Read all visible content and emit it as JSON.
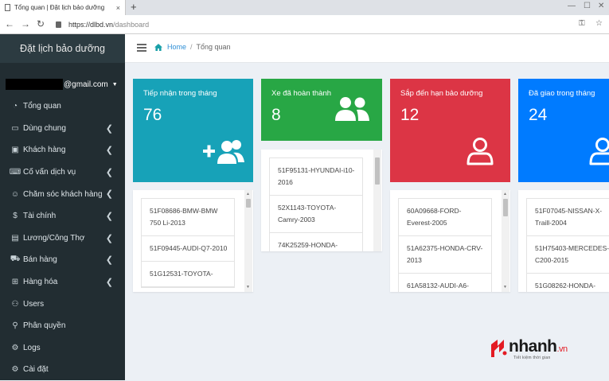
{
  "browser": {
    "tab_title": "Tổng quan | Đặt lịch bảo dưỡng",
    "tab_close": "×",
    "new_tab": "+",
    "url_scheme_host": "https://dlbd.vn",
    "url_path": "/dashboard"
  },
  "sidebar": {
    "brand": "Đặt lịch bảo dưỡng",
    "user_email": "@gmail.com",
    "items": [
      {
        "label": "Tổng quan",
        "icon": "dashboard-icon",
        "has_children": false
      },
      {
        "label": "Dùng chung",
        "icon": "folders-icon",
        "has_children": true
      },
      {
        "label": "Khách hàng",
        "icon": "id-card-icon",
        "has_children": true
      },
      {
        "label": "Cố vấn dịch vụ",
        "icon": "advisor-icon",
        "has_children": true
      },
      {
        "label": "Chăm sóc khách hàng",
        "icon": "support-icon",
        "has_children": true
      },
      {
        "label": "Tài chính",
        "icon": "dollar-icon",
        "has_children": true
      },
      {
        "label": "Lương/Công Thợ",
        "icon": "clipboard-icon",
        "has_children": true
      },
      {
        "label": "Bán hàng",
        "icon": "cart-icon",
        "has_children": true
      },
      {
        "label": "Hàng hóa",
        "icon": "gift-icon",
        "has_children": true
      },
      {
        "label": "Users",
        "icon": "users-icon",
        "has_children": false
      },
      {
        "label": "Phân quyền",
        "icon": "user-key-icon",
        "has_children": false
      },
      {
        "label": "Logs",
        "icon": "gear-icon",
        "has_children": false
      },
      {
        "label": "Cài đặt",
        "icon": "gear-icon",
        "has_children": false
      }
    ]
  },
  "breadcrumb": {
    "home": "Home",
    "separator": "/",
    "current": "Tổng quan"
  },
  "cards": [
    {
      "label": "Tiếp nhận trong tháng",
      "count": "76",
      "color": "#17a2b8",
      "icon": "user-plus-icon",
      "items": [
        "51F08686-BMW-BMW 750 Li-2013",
        "51F09445-AUDI-Q7-2010",
        "51G12531-TOYOTA-"
      ]
    },
    {
      "label": "Xe đã hoàn thành",
      "count": "8",
      "color": "#28a745",
      "icon": "users-icon",
      "items": [
        "51F95131-HYUNDAI-i10-2016",
        "52X1143-TOYOTA-Camry-2003",
        "74K25259-HONDA-"
      ]
    },
    {
      "label": "Sắp đến hạn bảo dưỡng",
      "count": "12",
      "color": "#dc3545",
      "icon": "user-icon",
      "items": [
        "60A09668-FORD-Everest-2005",
        "51A62375-HONDA-CRV-2013",
        "61A58132-AUDI-A6-"
      ]
    },
    {
      "label": "Đã giao trong tháng",
      "count": "24",
      "color": "#007bff",
      "icon": "user-icon",
      "items": [
        "51F07045-NISSAN-X-Traill-2004",
        "51H75403-MERCEDES-C200-2015",
        "51G08262-HONDA-"
      ]
    }
  ],
  "watermark": {
    "brand": "nhanh",
    "domain": ".vn",
    "tagline": "Tiết kiệm thời gian"
  }
}
